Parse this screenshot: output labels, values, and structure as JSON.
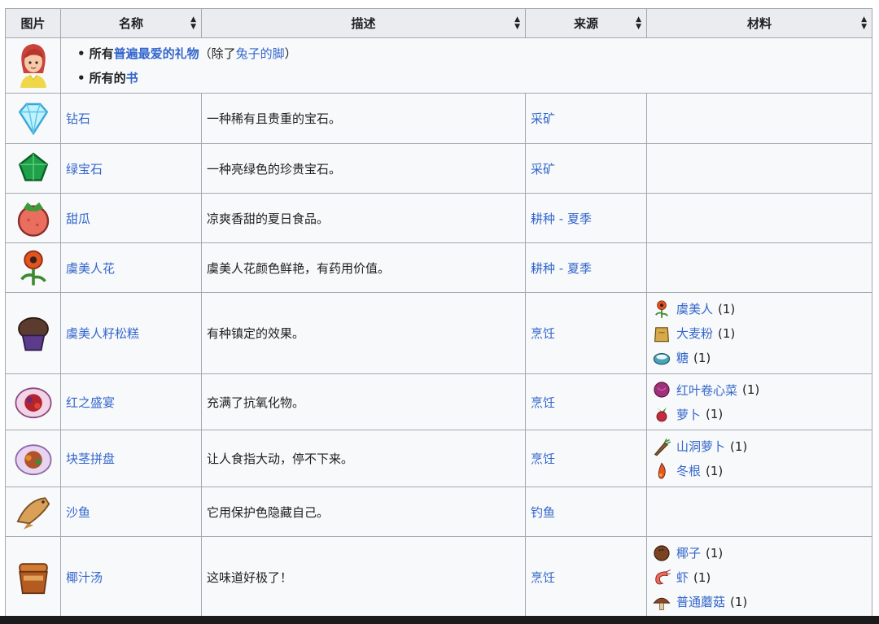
{
  "headers": {
    "image": "图片",
    "name": "名称",
    "description": "描述",
    "source": "来源",
    "ingredients": "材料"
  },
  "favorites_row": {
    "line1_prefix": "所有",
    "line1_link": "普遍最爱的礼物",
    "line1_paren_open": "（除了",
    "line1_paren_link": "兔子的脚",
    "line1_paren_close": "）",
    "line2_prefix": "所有的",
    "line2_link": "书"
  },
  "items": [
    {
      "name": "钻石",
      "description": "一种稀有且贵重的宝石。",
      "source": "采矿",
      "icon": "diamond-icon",
      "ingredients": []
    },
    {
      "name": "绿宝石",
      "description": "一种亮绿色的珍贵宝石。",
      "source": "采矿",
      "icon": "emerald-icon",
      "ingredients": []
    },
    {
      "name": "甜瓜",
      "description": "凉爽香甜的夏日食品。",
      "source": "耕种 - 夏季",
      "icon": "melon-icon",
      "ingredients": []
    },
    {
      "name": "虞美人花",
      "description": "虞美人花颜色鲜艳，有药用价值。",
      "source": "耕种 - 夏季",
      "icon": "poppy-icon",
      "ingredients": []
    },
    {
      "name": "虞美人籽松糕",
      "description": "有种镇定的效果。",
      "source": "烹饪",
      "icon": "poppyseed-muffin-icon",
      "ingredients": [
        {
          "name": "虞美人",
          "qty": "(1)",
          "icon": "poppy-icon"
        },
        {
          "name": "大麦粉",
          "qty": "(1)",
          "icon": "wheat-flour-icon"
        },
        {
          "name": "糖",
          "qty": "(1)",
          "icon": "sugar-icon"
        }
      ]
    },
    {
      "name": "红之盛宴",
      "description": "充满了抗氧化物。",
      "source": "烹饪",
      "icon": "red-plate-icon",
      "ingredients": [
        {
          "name": "红叶卷心菜",
          "qty": "(1)",
          "icon": "red-cabbage-icon"
        },
        {
          "name": "萝卜",
          "qty": "(1)",
          "icon": "radish-icon"
        }
      ]
    },
    {
      "name": "块茎拼盘",
      "description": "让人食指大动，停不下来。",
      "source": "烹饪",
      "icon": "root-platter-icon",
      "ingredients": [
        {
          "name": "山洞萝卜",
          "qty": "(1)",
          "icon": "cave-carrot-icon"
        },
        {
          "name": "冬根",
          "qty": "(1)",
          "icon": "winter-root-icon"
        }
      ]
    },
    {
      "name": "沙鱼",
      "description": "它用保护色隐藏自己。",
      "source": "钓鱼",
      "icon": "sandfish-icon",
      "ingredients": []
    },
    {
      "name": "椰汁汤",
      "description": "这味道好极了！",
      "source": "烹饪",
      "icon": "coconut-soup-icon",
      "ingredients": [
        {
          "name": "椰子",
          "qty": "(1)",
          "icon": "coconut-icon"
        },
        {
          "name": "虾",
          "qty": "(1)",
          "icon": "shrimp-icon"
        },
        {
          "name": "普通蘑菇",
          "qty": "(1)",
          "icon": "common-mushroom-icon"
        }
      ]
    }
  ],
  "colors": {
    "link": "#3366cc",
    "header_bg": "#eaecf0",
    "row_bg": "#f8f9fa",
    "border": "#a2a9b1"
  }
}
